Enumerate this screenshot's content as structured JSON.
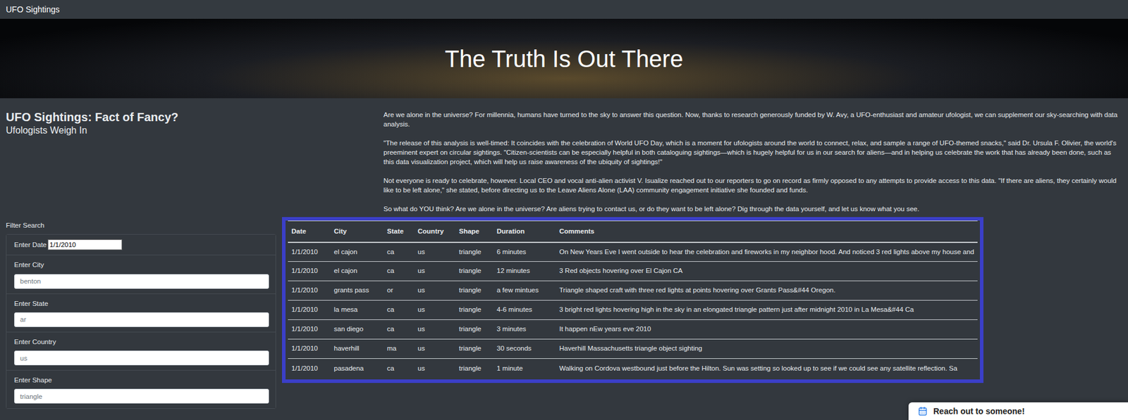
{
  "navbar": {
    "title": "UFO Sightings"
  },
  "hero": {
    "title": "The Truth Is Out There"
  },
  "intro": {
    "heading": "UFO Sightings: Fact of Fancy?",
    "subheading": "Ufologists Weigh In",
    "paragraphs": [
      "Are we alone in the universe? For millennia, humans have turned to the sky to answer this question. Now, thanks to research generously funded by W. Avy, a UFO-enthusiast and amateur ufologist, we can supplement our sky-searching with data analysis.",
      "\"The release of this analysis is well-timed: It coincides with the celebration of World UFO Day, which is a moment for ufologists around the world to connect, relax, and sample a range of UFO-themed snacks,\" said Dr. Ursula F. Olivier, the world's preeminent expert on circular sightings. \"Citizen-scientists can be especially helpful in both cataloguing sightings—which is hugely helpful for us in our search for aliens—and in helping us celebrate the work that has already been done, such as this data visualization project, which will help us raise awareness of the ubiquity of sightings!\"",
      "Not everyone is ready to celebrate, however. Local CEO and vocal anti-alien activist V. Isualize reached out to our reporters to go on record as firmly opposed to any attempts to provide access to this data. \"If there are aliens, they certainly would like to be left alone,\" she stated, before directing us to the Leave Aliens Alone (LAA) community engagement initiative she founded and funds.",
      "So what do YOU think? Are we alone in the universe? Are aliens trying to contact us, or do they want to be left alone? Dig through the data yourself, and let us know what you see."
    ]
  },
  "filters": {
    "title": "Filter Search",
    "fields": [
      {
        "label": "Enter Date",
        "value": "1/1/2010",
        "placeholder": "",
        "kind": "inline"
      },
      {
        "label": "Enter City",
        "value": "",
        "placeholder": "benton",
        "kind": "stacked"
      },
      {
        "label": "Enter State",
        "value": "",
        "placeholder": "ar",
        "kind": "stacked"
      },
      {
        "label": "Enter Country",
        "value": "",
        "placeholder": "us",
        "kind": "stacked"
      },
      {
        "label": "Enter Shape",
        "value": "",
        "placeholder": "triangle",
        "kind": "stacked"
      }
    ]
  },
  "table": {
    "columns": [
      "Date",
      "City",
      "State",
      "Country",
      "Shape",
      "Duration",
      "Comments"
    ],
    "rows": [
      [
        "1/1/2010",
        "el cajon",
        "ca",
        "us",
        "triangle",
        "6 minutes",
        "On New Years Eve I went outside to hear the celebration and fireworks in my neighbor hood. And noticed 3 red lights above my house and"
      ],
      [
        "1/1/2010",
        "el cajon",
        "ca",
        "us",
        "triangle",
        "12 minutes",
        "3 Red objects hovering over El Cajon CA"
      ],
      [
        "1/1/2010",
        "grants pass",
        "or",
        "us",
        "triangle",
        "a few mintues",
        "Triangle shaped craft with three red lights at points hovering over Grants Pass&#44 Oregon."
      ],
      [
        "1/1/2010",
        "la mesa",
        "ca",
        "us",
        "triangle",
        "4-6 minutes",
        "3 bright red lights hovering high in the sky in an elongated triangle pattern just after midnight 2010 in La Mesa&#44 Ca"
      ],
      [
        "1/1/2010",
        "san diego",
        "ca",
        "us",
        "triangle",
        "3 minutes",
        "It happen nEw years eve 2010"
      ],
      [
        "1/1/2010",
        "haverhill",
        "ma",
        "us",
        "triangle",
        "30 seconds",
        "Haverhill Massachusetts triangle object sighting"
      ],
      [
        "1/1/2010",
        "pasadena",
        "ca",
        "us",
        "triangle",
        "1 minute",
        "Walking on Cordova westbound just before the Hilton. Sun was setting so looked up to see if we could see any satellite reflection. Sa"
      ]
    ]
  },
  "popup": {
    "text": "Reach out to someone!"
  }
}
